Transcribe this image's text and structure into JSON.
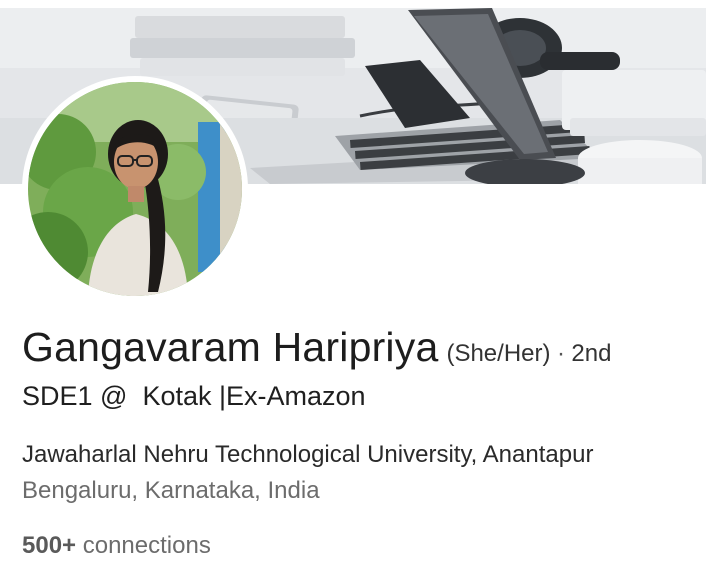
{
  "profile": {
    "name": "Gangavaram Haripriya",
    "pronouns": "(She/Her)",
    "separator": "·",
    "degree": "2nd",
    "headline": "SDE1 @  Kotak |Ex-Amazon",
    "education": "Jawaharlal Nehru Technological University, Anantapur",
    "location": "Bengaluru, Karnataka, India",
    "connections_count": "500+",
    "connections_label": "connections"
  },
  "banner": {
    "image": "laptop-desk-background"
  },
  "avatar": {
    "image": "profile-photo"
  }
}
